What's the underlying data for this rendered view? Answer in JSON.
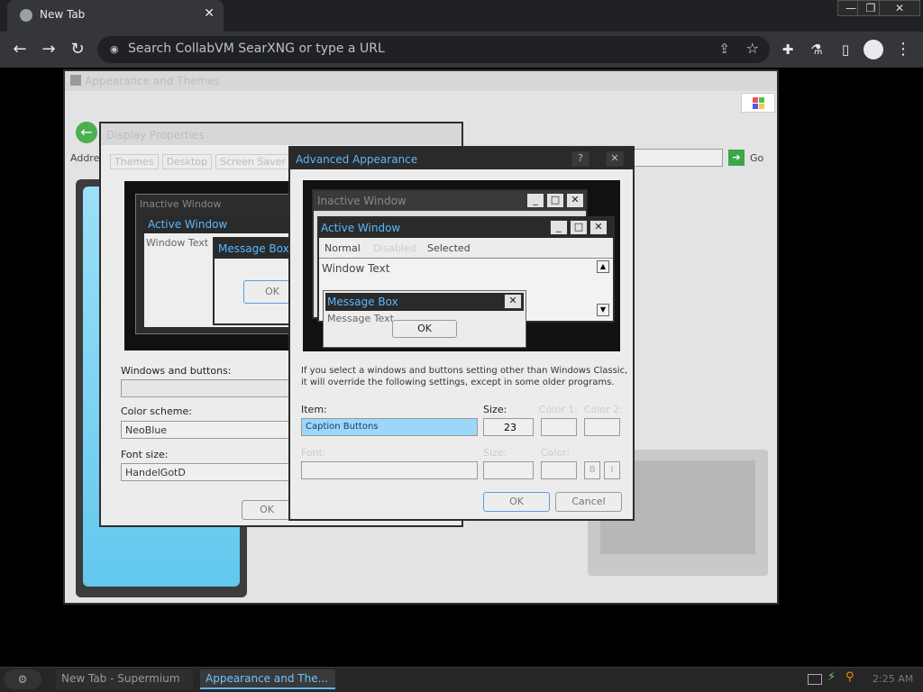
{
  "browser": {
    "tab_title": "New Tab",
    "url_placeholder": "Search CollabVM SearXNG or type a URL"
  },
  "appearance_window": {
    "title": "Appearance and Themes",
    "address_label": "Address",
    "go_label": "Go"
  },
  "display_properties": {
    "title": "Display Properties",
    "tabs": [
      "Themes",
      "Desktop",
      "Screen Saver"
    ],
    "preview": {
      "inactive_title": "Inactive Window",
      "active_title": "Active Window",
      "window_text": "Window Text",
      "message_box_title": "Message Box",
      "ok": "OK"
    },
    "windows_buttons_label": "Windows and buttons:",
    "windows_buttons_value": "",
    "color_scheme_label": "Color scheme:",
    "color_scheme_value": "NeoBlue",
    "font_size_label": "Font size:",
    "font_size_value": "HandelGotD",
    "ok_button": "OK"
  },
  "advanced": {
    "title": "Advanced Appearance",
    "preview": {
      "inactive_title": "Inactive Window",
      "active_title": "Active Window",
      "menu_normal": "Normal",
      "menu_disabled": "Disabled",
      "menu_selected": "Selected",
      "window_text": "Window Text",
      "message_box_title": "Message Box",
      "message_text": "Message Text",
      "ok": "OK"
    },
    "note": "If you select a windows and buttons setting other than Windows Classic, it will override the following settings, except in some older programs.",
    "item_label": "Item:",
    "item_value": "Caption Buttons",
    "size_label": "Size:",
    "size_value": "23",
    "color1_label": "Color 1:",
    "color2_label": "Color 2:",
    "font_label": "Font:",
    "font_size_label": "Size:",
    "font_color_label": "Color:",
    "bold_label": "B",
    "italic_label": "I",
    "ok_button": "OK",
    "cancel_button": "Cancel"
  },
  "taskbar": {
    "item1": "New Tab - Supermium",
    "item2": "Appearance and The...",
    "clock": "2:25 AM"
  }
}
